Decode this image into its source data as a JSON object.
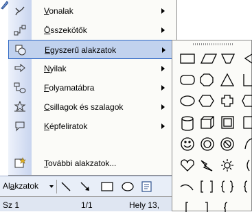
{
  "menu": {
    "items": [
      {
        "label": "Vonalak",
        "icon": "lines-icon",
        "submenu": true,
        "highlighted": false
      },
      {
        "label": "Összekötők",
        "icon": "connectors-icon",
        "submenu": true,
        "highlighted": false
      },
      {
        "label": "Egyszerű alakzatok",
        "icon": "basic-shapes-icon",
        "submenu": true,
        "highlighted": true
      },
      {
        "label": "Nyilak",
        "icon": "block-arrows-icon",
        "submenu": true,
        "highlighted": false
      },
      {
        "label": "Folyamatábra",
        "icon": "flowchart-icon",
        "submenu": true,
        "highlighted": false
      },
      {
        "label": "Csillagok és szalagok",
        "icon": "stars-banners-icon",
        "submenu": true,
        "highlighted": false
      },
      {
        "label": "Képfeliratok",
        "icon": "callouts-icon",
        "submenu": true,
        "highlighted": false
      },
      {
        "label": "További alakzatok...",
        "icon": "more-shapes-icon",
        "submenu": false,
        "highlighted": false
      }
    ]
  },
  "toolbar": {
    "autoshapes_label": "Alakzatok",
    "tools": [
      "line-tool-icon",
      "arrow-tool-icon",
      "rectangle-tool-icon",
      "oval-tool-icon",
      "textbox-tool-icon"
    ]
  },
  "statusbar": {
    "section": "Sz 1",
    "page": "1/1",
    "position": "Hely 13,"
  },
  "palette": {
    "title": "Egyszerű alakzatok",
    "shapes": [
      "rectangle",
      "parallelogram",
      "trapezoid",
      "diamond-partial",
      "rounded-rectangle",
      "octagon",
      "triangle",
      "right-triangle-partial",
      "ellipse",
      "hexagon",
      "cross",
      "pentagon-partial",
      "can",
      "cube",
      "bevel",
      "folded-partial",
      "smiley-face",
      "donut",
      "no-symbol",
      "arc-partial",
      "heart",
      "lightning-bolt",
      "sun",
      "moon-partial",
      "arc",
      "double-bracket",
      "double-brace",
      "partial",
      "left-bracket",
      "right-bracket",
      "left-brace",
      "partial"
    ]
  },
  "colors": {
    "highlight_bg": "#c1d2ee",
    "highlight_border": "#316ac5",
    "menu_bg": "#fbfbf8",
    "gutter": "#dbe4f5"
  }
}
